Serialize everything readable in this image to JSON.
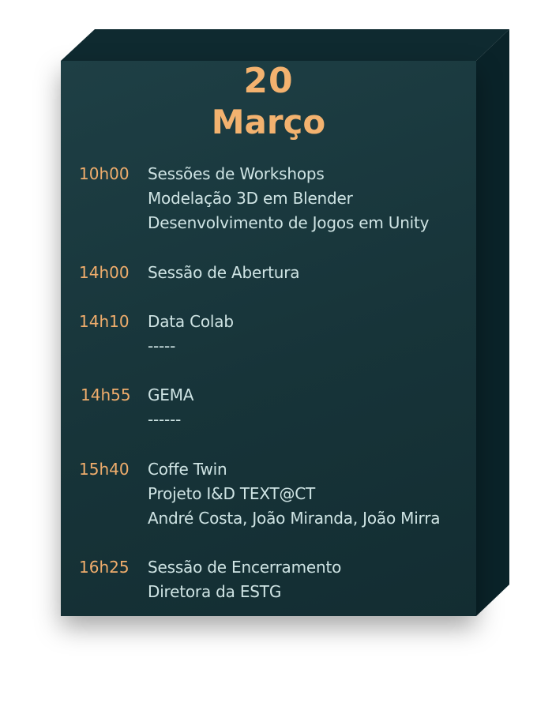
{
  "header": {
    "day": "20",
    "month": "Março"
  },
  "colors": {
    "face": "#1b3a3f",
    "side": "#0b252b",
    "accent": "#f3b26f",
    "text": "#cfe4e4"
  },
  "schedule": [
    {
      "time": "10h00",
      "lines": [
        "Sessões de Workshops",
        "Modelação 3D  em Blender",
        "Desenvolvimento de Jogos em Unity"
      ]
    },
    {
      "time": "14h00",
      "lines": [
        "Sessão de Abertura"
      ]
    },
    {
      "time": "14h10",
      "lines": [
        "Data Colab",
        "-----"
      ]
    },
    {
      "time": "14h55",
      "lines": [
        "GEMA",
        "------"
      ]
    },
    {
      "time": "15h40",
      "lines": [
        "Coffe Twin",
        "Projeto I&D TEXT@CT",
        "André Costa, João Miranda, João Mirra"
      ]
    },
    {
      "time": "16h25",
      "lines": [
        "Sessão de Encerramento",
        "Diretora da ESTG"
      ]
    }
  ]
}
